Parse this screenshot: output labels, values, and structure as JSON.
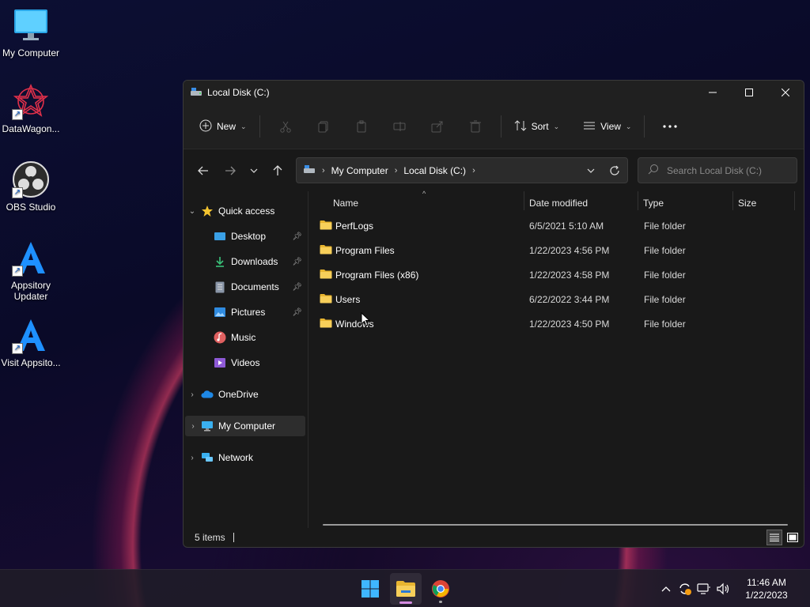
{
  "desktop": {
    "icons": [
      {
        "label": "My Computer"
      },
      {
        "label": "DataWagon..."
      },
      {
        "label": "OBS Studio"
      },
      {
        "label": "Appsitory Updater"
      },
      {
        "label": "Visit Appsito..."
      }
    ]
  },
  "window": {
    "title": "Local Disk (C:)",
    "toolbar": {
      "new_label": "New",
      "sort_label": "Sort",
      "view_label": "View"
    },
    "address": {
      "crumbs": [
        "My Computer",
        "Local Disk (C:)"
      ]
    },
    "search": {
      "placeholder": "Search Local Disk (C:)"
    },
    "nav": {
      "quick_access": "Quick access",
      "items": [
        {
          "label": "Desktop"
        },
        {
          "label": "Downloads"
        },
        {
          "label": "Documents"
        },
        {
          "label": "Pictures"
        },
        {
          "label": "Music"
        },
        {
          "label": "Videos"
        }
      ],
      "onedrive": "OneDrive",
      "my_computer": "My Computer",
      "network": "Network"
    },
    "columns": {
      "name": "Name",
      "date": "Date modified",
      "type": "Type",
      "size": "Size"
    },
    "files": [
      {
        "name": "PerfLogs",
        "date": "6/5/2021 5:10 AM",
        "type": "File folder"
      },
      {
        "name": "Program Files",
        "date": "1/22/2023 4:56 PM",
        "type": "File folder"
      },
      {
        "name": "Program Files (x86)",
        "date": "1/22/2023 4:58 PM",
        "type": "File folder"
      },
      {
        "name": "Users",
        "date": "6/22/2022 3:44 PM",
        "type": "File folder"
      },
      {
        "name": "Windows",
        "date": "1/22/2023 4:50 PM",
        "type": "File folder"
      }
    ],
    "status": {
      "items_count": "5 items"
    }
  },
  "taskbar": {
    "clock_time": "11:46 AM",
    "clock_date": "1/22/2023"
  },
  "colors": {
    "folder": "#f2c94c",
    "accent": "#4cc2ff",
    "taskbar_indicator": "#d48ae0"
  }
}
